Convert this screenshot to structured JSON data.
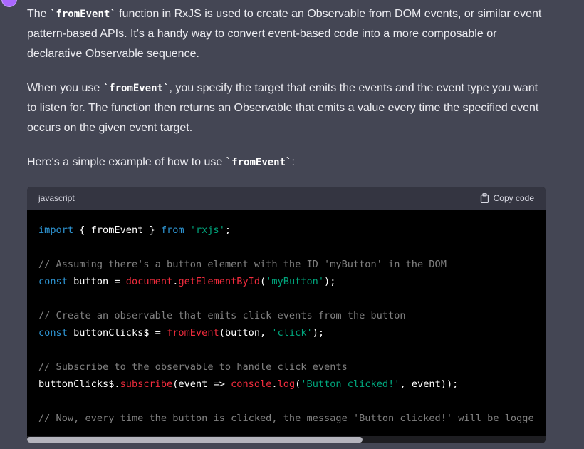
{
  "paragraphs": {
    "p1": {
      "t1": "The ",
      "c1": "`fromEvent`",
      "t2": " function in RxJS is used to create an Observable from DOM events, or similar event pattern-based APIs. It's a handy way to convert event-based code into a more composable or declarative Observable sequence."
    },
    "p2": {
      "t1": "When you use ",
      "c1": "`fromEvent`",
      "t2": ", you specify the target that emits the events and the event type you want to listen for. The function then returns an Observable that emits a value every time the specified event occurs on the given event target."
    },
    "p3": {
      "t1": "Here's a simple example of how to use ",
      "c1": "`fromEvent`",
      "t2": ":"
    }
  },
  "code_block": {
    "language": "javascript",
    "copy_label": "Copy code",
    "copy_icon": "clipboard-icon",
    "lines": [
      [
        {
          "t": "import",
          "k": "kw"
        },
        {
          "t": " { fromEvent } ",
          "k": "plain"
        },
        {
          "t": "from",
          "k": "kw"
        },
        {
          "t": " ",
          "k": "plain"
        },
        {
          "t": "'rxjs'",
          "k": "str"
        },
        {
          "t": ";",
          "k": "plain"
        }
      ],
      [],
      [
        {
          "t": "// Assuming there's a button element with the ID 'myButton' in the DOM",
          "k": "cmt"
        }
      ],
      [
        {
          "t": "const",
          "k": "kw"
        },
        {
          "t": " button = ",
          "k": "plain"
        },
        {
          "t": "document",
          "k": "fn"
        },
        {
          "t": ".",
          "k": "plain"
        },
        {
          "t": "getElementById",
          "k": "fn"
        },
        {
          "t": "(",
          "k": "plain"
        },
        {
          "t": "'myButton'",
          "k": "str"
        },
        {
          "t": ");",
          "k": "plain"
        }
      ],
      [],
      [
        {
          "t": "// Create an observable that emits click events from the button",
          "k": "cmt"
        }
      ],
      [
        {
          "t": "const",
          "k": "kw"
        },
        {
          "t": " buttonClicks$ = ",
          "k": "plain"
        },
        {
          "t": "fromEvent",
          "k": "fn"
        },
        {
          "t": "(button, ",
          "k": "plain"
        },
        {
          "t": "'click'",
          "k": "str"
        },
        {
          "t": ");",
          "k": "plain"
        }
      ],
      [],
      [
        {
          "t": "// Subscribe to the observable to handle click events",
          "k": "cmt"
        }
      ],
      [
        {
          "t": "buttonClicks$.",
          "k": "plain"
        },
        {
          "t": "subscribe",
          "k": "fn"
        },
        {
          "t": "(event => ",
          "k": "plain"
        },
        {
          "t": "console",
          "k": "fn"
        },
        {
          "t": ".",
          "k": "plain"
        },
        {
          "t": "log",
          "k": "fn"
        },
        {
          "t": "(",
          "k": "plain"
        },
        {
          "t": "'Button clicked!'",
          "k": "str"
        },
        {
          "t": ", event));",
          "k": "plain"
        }
      ],
      [],
      [
        {
          "t": "// Now, every time the button is clicked, the message 'Button clicked!' will be logge",
          "k": "cmt"
        }
      ]
    ],
    "scroll_position": 0
  },
  "colors": {
    "page_bg": "#444654",
    "code_bg": "#000000",
    "code_header_bg": "#343541",
    "keyword": "#2e95d3",
    "string": "#00a67d",
    "function": "#f22c3d",
    "comment": "#8e8e8e",
    "avatar": "#ab68ff"
  }
}
